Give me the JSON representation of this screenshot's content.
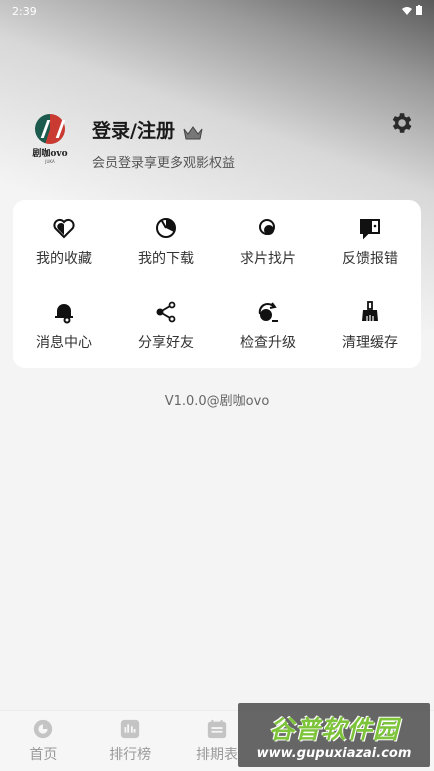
{
  "status_bar": {
    "time": "2:39"
  },
  "profile": {
    "avatar_text": "剧咖ovo",
    "avatar_sub": "JUKA",
    "title": "登录/注册",
    "subtitle": "会员登录享更多观影权益"
  },
  "menu": {
    "items": [
      {
        "label": "我的收藏",
        "icon": "heart-icon"
      },
      {
        "label": "我的下载",
        "icon": "download-icon"
      },
      {
        "label": "求片找片",
        "icon": "search-film-icon"
      },
      {
        "label": "反馈报错",
        "icon": "feedback-icon"
      },
      {
        "label": "消息中心",
        "icon": "bell-icon"
      },
      {
        "label": "分享好友",
        "icon": "share-icon"
      },
      {
        "label": "检查升级",
        "icon": "update-icon"
      },
      {
        "label": "清理缓存",
        "icon": "broom-icon"
      }
    ]
  },
  "version": "V1.0.0@剧咖ovo",
  "bottom_nav": {
    "items": [
      {
        "label": "首页",
        "icon": "home-icon"
      },
      {
        "label": "排行榜",
        "icon": "ranking-icon"
      },
      {
        "label": "排期表",
        "icon": "calendar-icon"
      },
      {
        "label": "",
        "icon": ""
      },
      {
        "label": "",
        "icon": ""
      }
    ]
  },
  "watermark": {
    "main": "谷普软件园",
    "url": "www.gupuxiazai.com"
  }
}
